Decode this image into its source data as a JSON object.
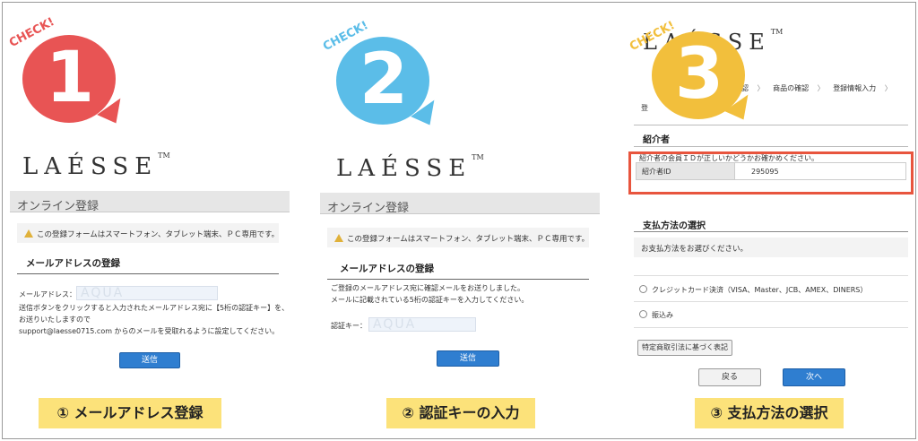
{
  "common": {
    "check_label": "CHECK!",
    "logo_text": "LAÉSSE",
    "logo_tm": "TM"
  },
  "panel1": {
    "step_number": "1",
    "bubble_color": "#e85454",
    "title": "オンライン登録",
    "notice": "この登録フォームはスマートフォン、タブレット端末、ＰＣ専用です。",
    "section_heading": "メールアドレスの登録",
    "email_label": "メールアドレス：",
    "email_value": "AQUA",
    "line1": "送信ボタンをクリックすると入力されたメールアドレス宛に【5桁の認証キー】を、",
    "line2": "お送りいたしますので",
    "line3": "support@laesse0715.com からのメールを受取れるように設定してください。",
    "submit_label": "送信",
    "caption": "① メールアドレス登録"
  },
  "panel2": {
    "step_number": "2",
    "bubble_color": "#5bbde8",
    "title": "オンライン登録",
    "notice": "この登録フォームはスマートフォン、タブレット端末、ＰＣ専用です。",
    "section_heading": "メールアドレスの登録",
    "line1": "ご登録のメールアドレス宛に確認メールをお送りしました。",
    "line2": "メールに記載されている5桁の認証キーを入力してください。",
    "key_label": "認証キー：",
    "key_value": "AQUA",
    "submit_label": "送信",
    "caption": "② 認証キーの入力"
  },
  "panel3": {
    "step_number": "3",
    "bubble_color": "#f2bf3c",
    "breadcrumb": [
      "認",
      "商品の確認",
      "登録情報入力"
    ],
    "breadcrumb_partial": "登",
    "referrer_heading": "紹介者",
    "referrer_note": "紹介者の会員ＩＤが正しいかどうかお確かめください。",
    "referrer_id_label": "紹介者ID",
    "referrer_id_value": "295095",
    "highlight_color": "#e8553e",
    "payment_heading": "支払方法の選択",
    "payment_prompt": "お支払方法をお選びください。",
    "payment_options": [
      "クレジットカード決済（VISA、Master、JCB、AMEX、DINERS）",
      "振込み"
    ],
    "law_button": "特定商取引法に基づく表記",
    "back_button": "戻る",
    "next_button": "次へ",
    "caption": "③ 支払方法の選択"
  }
}
